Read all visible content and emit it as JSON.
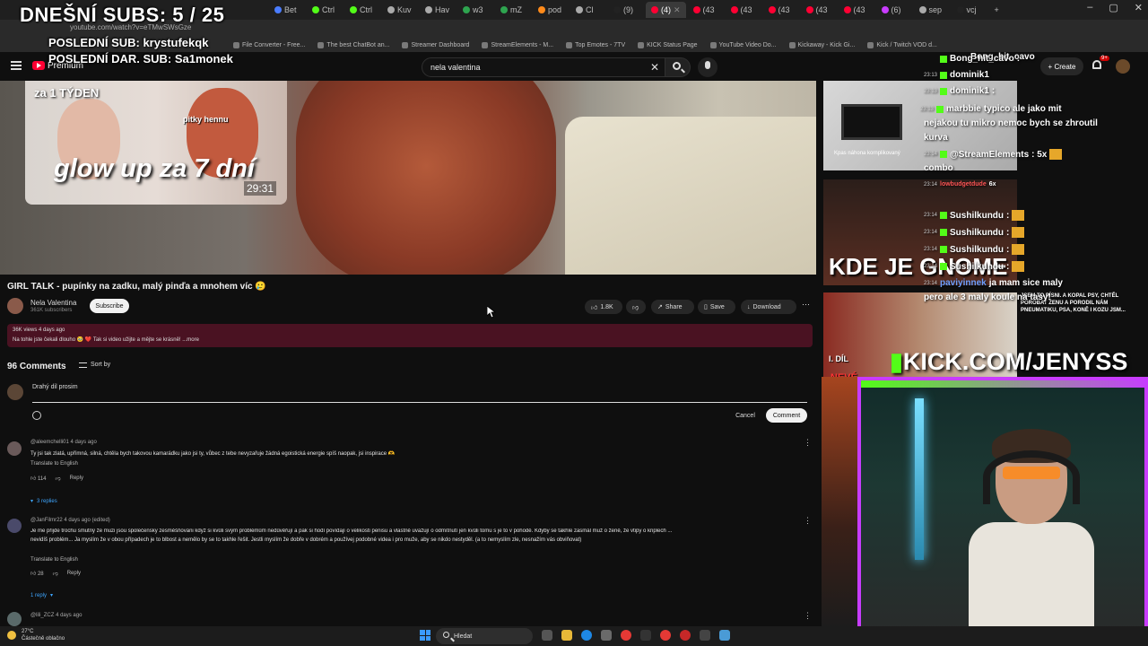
{
  "overlay": {
    "subs_count": "DNEŠNÍ SUBS: 5 / 25",
    "last_sub": "POSLEDNÍ SUB: krystufekqk",
    "last_donation": "POSLEDNÍ DAR. SUB: Sa1monek"
  },
  "browser": {
    "url": "youtube.com/watch?v=eTMwSWsGze",
    "bookmarks": [
      "File Converter - Free...",
      "The best ChatBot an...",
      "Streamer Dashboard",
      "StreamElements - M...",
      "Top Emotes - 7TV",
      "KICK Status Page",
      "YouTube Video Do...",
      "Kickaway - Kick Gi...",
      "Kick / Twitch VOD d..."
    ]
  },
  "youtube": {
    "premium_label": "Premium",
    "search_query": "nela valentina",
    "create_label": "Create",
    "notif_count": "9+"
  },
  "thumbnail": {
    "top_text": "za 1 TÝDEN",
    "sticker": "pitky hennu",
    "title": "glow up za 7 dní",
    "duration": "29:31"
  },
  "video": {
    "title": "GIRL TALK - pupínky na zadku, malý pinďa a mnohem víc 🥲",
    "channel": "Nela Valentina",
    "subscribers": "361K subscribers",
    "subscribe_label": "Subscribe",
    "likes": "1.8K",
    "share_label": "Share",
    "save_label": "Save",
    "download_label": "Download",
    "views_meta": "36K views  4 days ago",
    "description": "Na tohle jste čekali dlouho 🥹 ❤️ Tak si video užijte a mějte se krásně! ...more"
  },
  "comments": {
    "count_label": "96 Comments",
    "sort_label": "Sort by",
    "input_text": "Drahý dil prosim",
    "cancel_label": "Cancel",
    "comment_label": "Comment",
    "items": [
      {
        "author": "@aleemchelli01  4 days ago",
        "text": "Ty jsi tak zlatá, upřímná, silná, chtěla bych takovou kamarádku jako jsi ty, vůbec z tebe nevyzařuje žádná egoistická energie spíš naopak, jsi inspirace 🫶",
        "translate": "Translate to English",
        "likes": "114",
        "reply_label": "Reply",
        "replies": "3 replies"
      },
      {
        "author": "@JanFilmr22  4 days ago (edited)",
        "text": "Je me přijde trochu smutný že muzi jsou společensky zesměšňováni když si kvůli svým problémům nedůvěřují a pak si hodí povídají o velikosti penisu a vlastně uvažují o odmítnutí jen kvůli tomu s je to v pohodě. Kdyby se takhle zasmál muž o ženě, že vtipy o kriplech ...",
        "text2": "nevidíš problém... Ja myslím že v obou případech je to blbost a nemělo by se to takhle řešit. Jestli myslím že dobře v dobrém a používej podobné videa i pro muže, aby se nikdo nestyděl. (a to nemyslím zle, nesnažím vás obviňovat)",
        "translate": "Translate to English",
        "likes": "28",
        "reply_label": "Reply",
        "replies": "1 reply"
      },
      {
        "author": "@lili_ZCZ  4 days ago"
      }
    ]
  },
  "chat": {
    "lines": [
      {
        "time": "",
        "nick": "Bong_hit_cavo",
        "msg": ""
      },
      {
        "time": "23:13",
        "nick": "dominik1",
        "msg": ""
      },
      {
        "time": "23:13",
        "nick": "Bong_hit_cavo",
        "msg": ":"
      },
      {
        "time": "23:13",
        "nick": "dominik1",
        "msg": ":"
      },
      {
        "time": "23:13",
        "nick": "dominik1",
        "msg": ""
      },
      {
        "time": "23:13",
        "nick": "marbbie",
        "msg": "typico ale jako mit"
      },
      {
        "time": "",
        "nick": "",
        "msg": "nejakou tu mikro nemoc bych se zhroutil"
      },
      {
        "time": "",
        "nick": "",
        "msg": "kurva"
      },
      {
        "time": "23:14",
        "nick": "@StreamElements",
        "msg": ": 5x"
      },
      {
        "time": "",
        "nick": "",
        "msg": "combo"
      },
      {
        "time": "23:14",
        "nick": "lowbudgetdude",
        "msg": "6x"
      },
      {
        "time": "23:14",
        "nick": "Sushilkundu",
        "msg": ":"
      },
      {
        "time": "23:14",
        "nick": "Sushilkundu",
        "msg": ":"
      },
      {
        "time": "23:14",
        "nick": "Sushilkundu",
        "msg": ":"
      },
      {
        "time": "23:14",
        "nick": "Sushilkundu",
        "msg": ":"
      },
      {
        "time": "23:14",
        "nick": "paviyinnek",
        "msg": "ja mam sice maly"
      },
      {
        "time": "",
        "nick": "",
        "msg": "pero ale 3 maly koule na tasy!"
      }
    ]
  },
  "related": {
    "caption1": "Kpas náhona kornplikovaný",
    "big2": "KDE JE GNOME",
    "caption3": "JSEM TO PÍSNI. A KOPAL PSY, CHTĚL POROBAT ŽENU A PORODIL NÁM PNEUMATIKU, PSA, KONĚ I KOZU JSM...",
    "kick": "KICK.COM/JENYSS",
    "side_label": "NEVÉ"
  },
  "taskbar": {
    "temp": "27°C",
    "weather": "Částečně oblačno",
    "search": "Hledat"
  }
}
